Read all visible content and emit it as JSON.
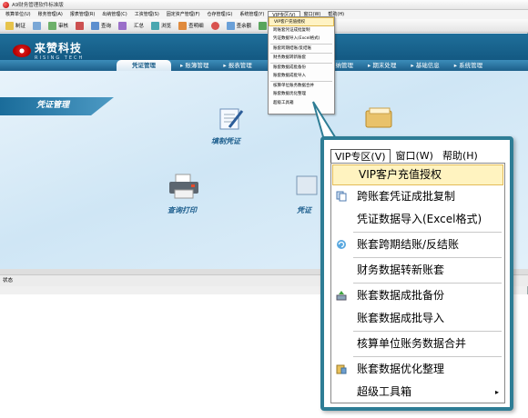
{
  "window": {
    "title": "A9财务管理软件标准版"
  },
  "menubar": {
    "items": [
      "核算单位(U)",
      "账务管理(A)",
      "报表管理(R)",
      "出纳管理(C)",
      "工资管理(S)",
      "固定资产管理(F)",
      "仓存管理(G)",
      "系统管理(Y)",
      "VIP专区(V)",
      "窗口(W)",
      "帮助(H)"
    ]
  },
  "toolbar": {
    "items": [
      "制证",
      "",
      "审核",
      "",
      "查询",
      "",
      "汇总",
      "浏览",
      "查明细",
      "",
      "查余额",
      "报表",
      ""
    ]
  },
  "brand": {
    "name_cn": "来赞科技",
    "name_en": "RISING TECH"
  },
  "nav": {
    "items": [
      "凭证管理",
      "账簿管理",
      "报表管理",
      "",
      "出纳管理",
      "期末处理",
      "基础信息",
      "系统管理"
    ]
  },
  "content": {
    "section": "凭证管理",
    "funcs": {
      "fill": "填制凭证",
      "query": "查询打印",
      "voucher": "凭证"
    }
  },
  "status": {
    "text": "状态"
  },
  "mini_menu": {
    "items": [
      "VIP客户充值授权",
      "跨账套凭证成批复制",
      "凭证数据导入(Excel格式)",
      "账套跨期结账/反结账",
      "财务数据转新账套",
      "账套数据成批备份",
      "账套数据成批导入",
      "核算单位账务数据合并",
      "账套数据优化整理",
      "超级工具箱"
    ]
  },
  "zoom": {
    "menubar": [
      "VIP专区(V)",
      "窗口(W)",
      "帮助(H)"
    ],
    "items": [
      {
        "label": "VIP客户充值授权",
        "icon": "",
        "submenu": false
      },
      {
        "label": "跨账套凭证成批复制",
        "icon": "copy-icon",
        "submenu": false
      },
      {
        "label": "凭证数据导入(Excel格式)",
        "icon": "",
        "submenu": false
      },
      {
        "label": "账套跨期结账/反结账",
        "icon": "refresh-icon",
        "submenu": false
      },
      {
        "label": "财务数据转新账套",
        "icon": "",
        "submenu": false
      },
      {
        "label": "账套数据成批备份",
        "icon": "backup-icon",
        "submenu": false
      },
      {
        "label": "账套数据成批导入",
        "icon": "",
        "submenu": false
      },
      {
        "label": "核算单位账务数据合并",
        "icon": "",
        "submenu": false
      },
      {
        "label": "账套数据优化整理",
        "icon": "optimize-icon",
        "submenu": false
      },
      {
        "label": "超级工具箱",
        "icon": "",
        "submenu": true
      }
    ],
    "arrow": "▸"
  }
}
